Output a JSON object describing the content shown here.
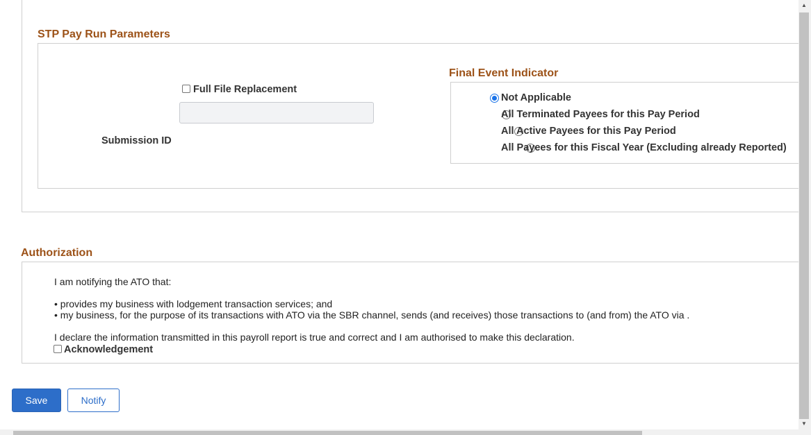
{
  "stp_section": {
    "title": "STP Pay Run Parameters",
    "full_file_replacement": {
      "label": "Full File Replacement",
      "checked": false
    },
    "submission_id": {
      "label": "Submission ID",
      "value": ""
    }
  },
  "final_event": {
    "title": "Final Event Indicator",
    "options": [
      {
        "label": "Not Applicable",
        "checked": true
      },
      {
        "label": "All Terminated Payees for this Pay Period",
        "checked": false
      },
      {
        "label": "All Active Payees for this Pay Period",
        "checked": false
      },
      {
        "label": "All Payees for this Fiscal Year (Excluding already Reported)",
        "checked": false
      }
    ]
  },
  "authorization": {
    "title": "Authorization",
    "intro": "I am notifying the ATO that:",
    "bullet1": "• provides my business with lodgement transaction services; and",
    "bullet2": "• my business, for the purpose of its transactions with ATO via the SBR channel, sends (and receives) those transactions to (and from) the ATO via .",
    "declaration": "I declare the information transmitted in this payroll report is true and correct and I am authorised to make this declaration.",
    "acknowledgement": {
      "label": "Acknowledgement",
      "checked": false
    }
  },
  "buttons": {
    "save_label": "Save",
    "notify_label": "Notify"
  },
  "colors": {
    "section_title": "#9c5218",
    "primary": "#2d6ec9"
  }
}
